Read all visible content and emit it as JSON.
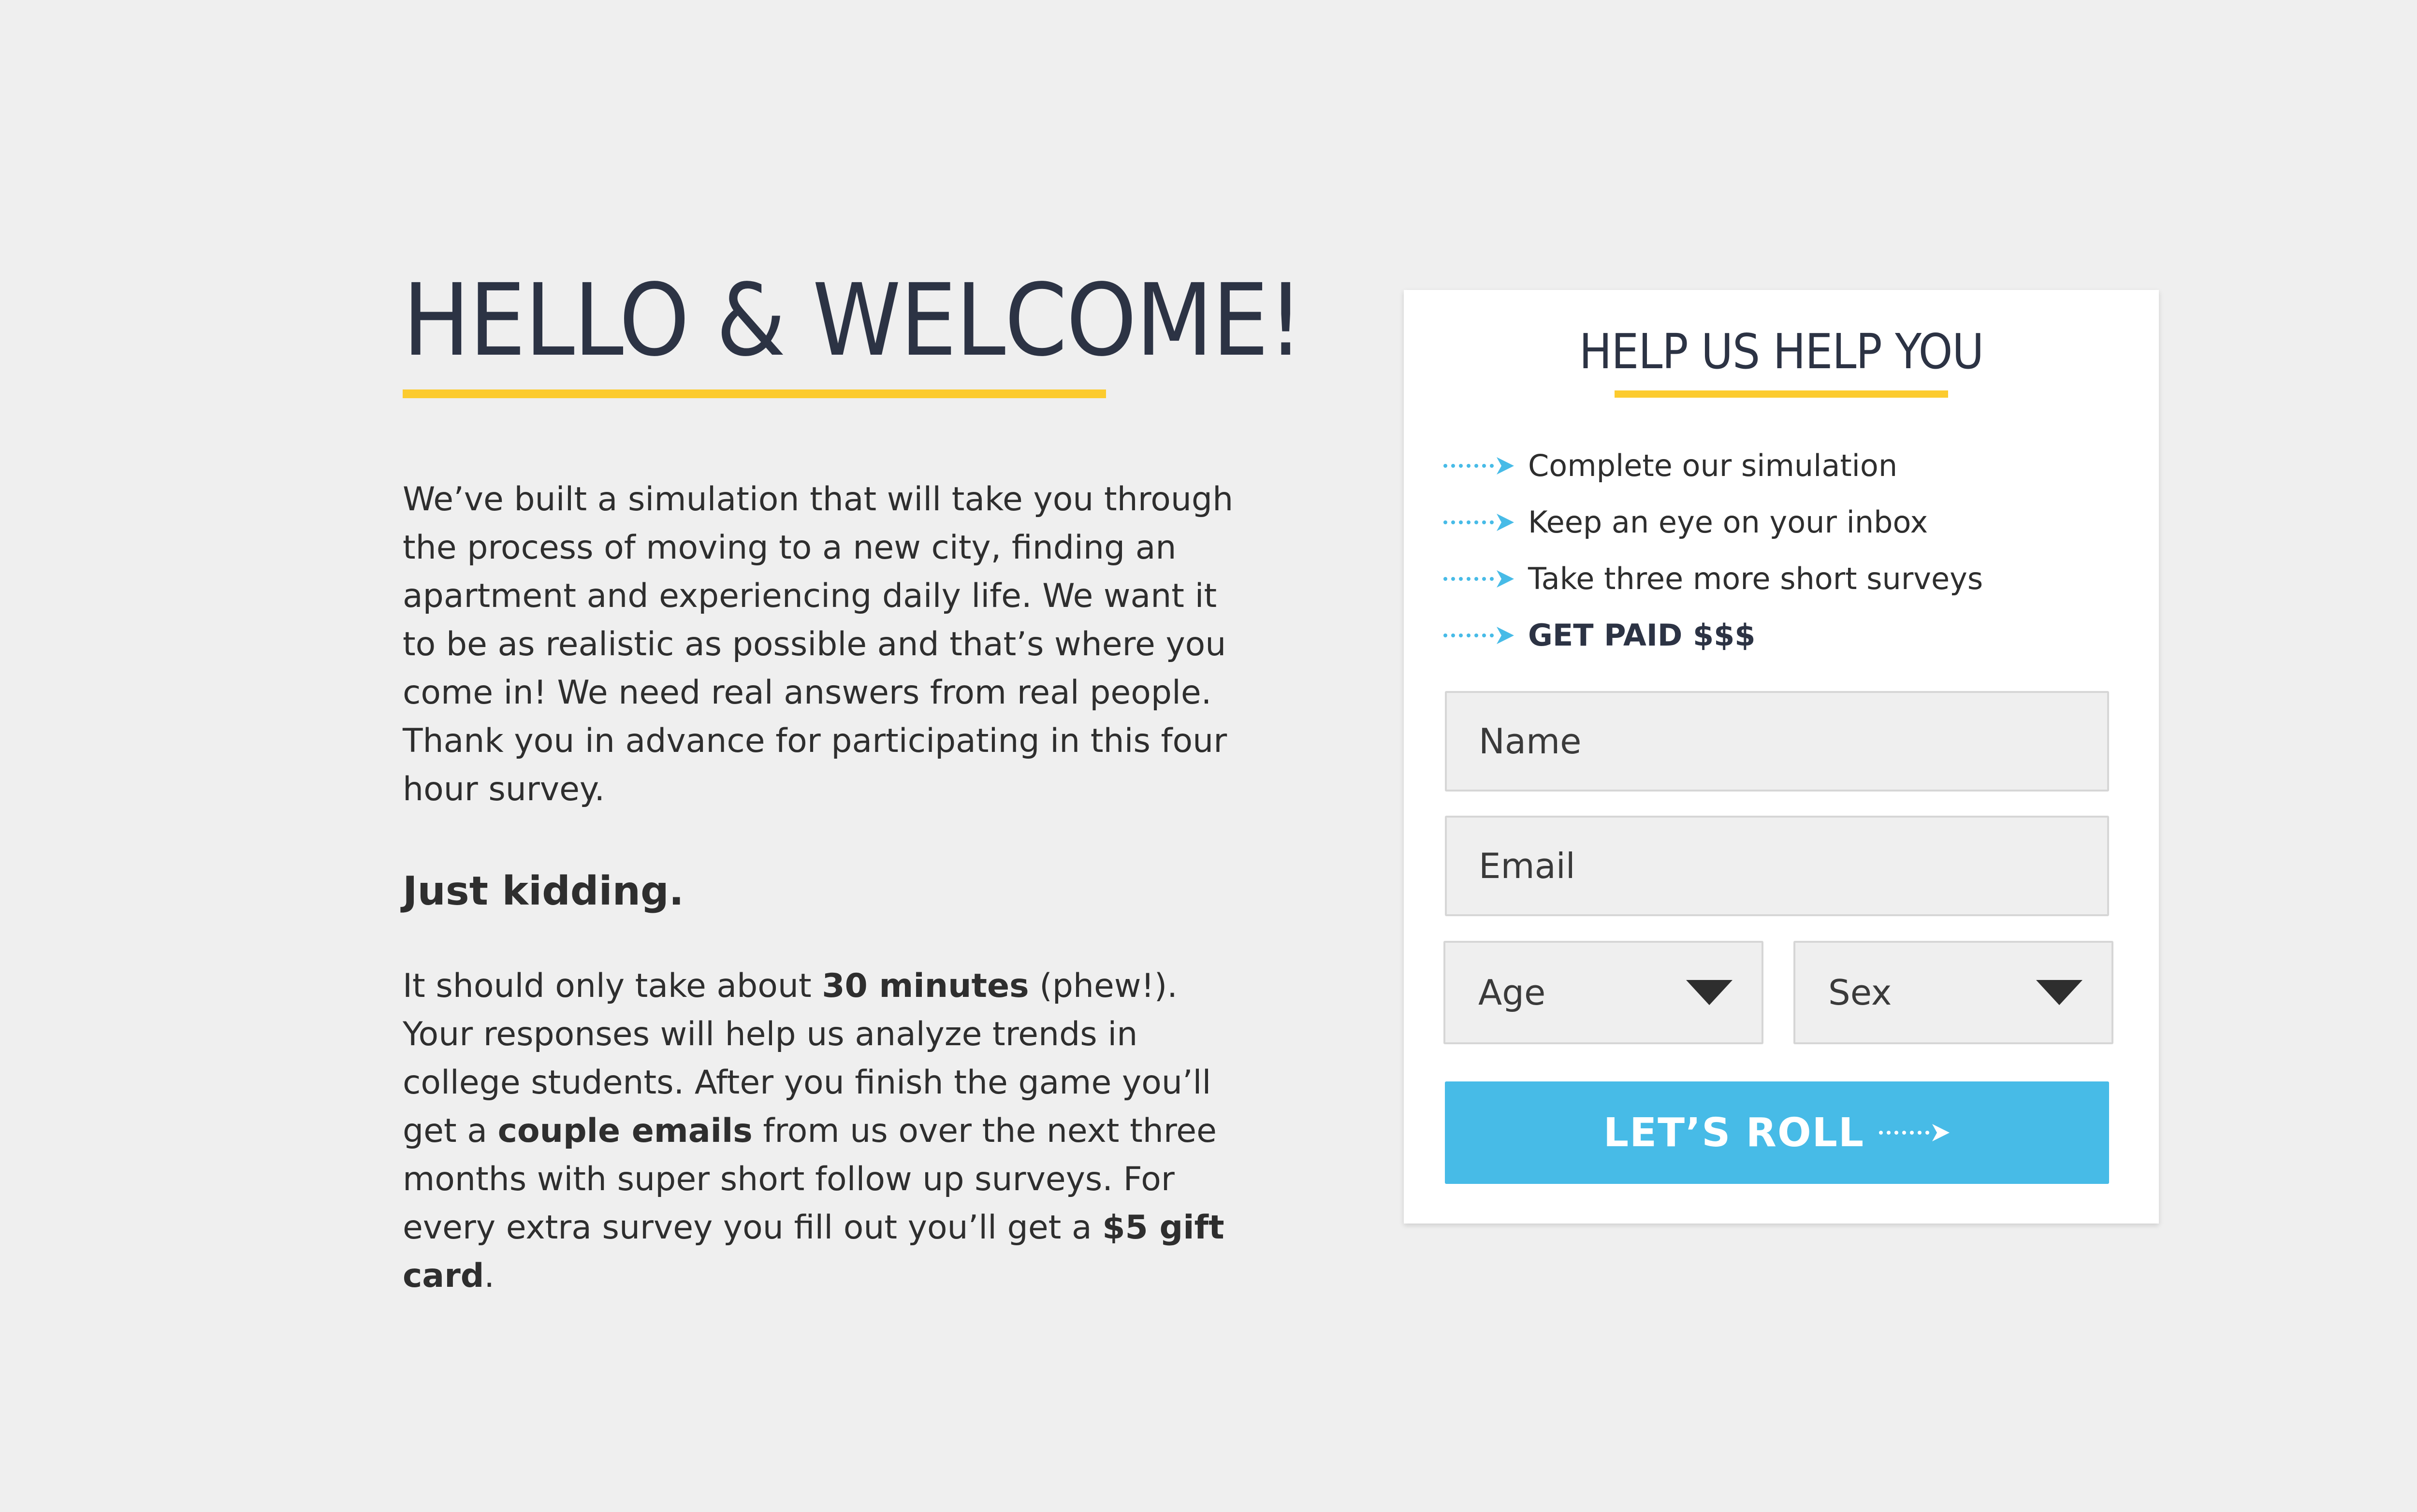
{
  "welcome": {
    "title": "HELLO & WELCOME!",
    "intro": "We’ve built a simulation that will take you through the process of moving to a new city, finding an apartment and experiencing daily life. We want it to be as realistic as possible and that’s where you come in! We need real answers from real people. Thank you in advance for participating in this four hour survey.",
    "kidding": "Just kidding.",
    "details": {
      "t1": "It should only take about ",
      "b1": "30 minutes",
      "t2": " (phew!). Your responses will help us analyze trends in college students. After you finish the game you’ll get a ",
      "b2": "couple emails",
      "t3": " from us over the next three months with super short follow up surveys. For every extra survey you fill out you’ll get a ",
      "b3": "$5 gift card",
      "t4": "."
    }
  },
  "form": {
    "title": "HELP US HELP YOU",
    "steps": [
      "Complete our simulation",
      "Keep an eye on your inbox",
      "Take three more short surveys",
      "GET PAID $$$"
    ],
    "name_placeholder": "Name",
    "email_placeholder": "Email",
    "age_label": "Age",
    "sex_label": "Sex",
    "submit_label": "LET’S ROLL"
  },
  "colors": {
    "background": "#efefef",
    "accent_yellow": "#fccb2f",
    "accent_blue": "#47bbe7",
    "heading": "#2c3344"
  },
  "icons": {
    "step_marker": "dotted-arrow-icon",
    "select_caret": "caret-down-icon",
    "button_arrow": "dotted-arrow-icon"
  }
}
